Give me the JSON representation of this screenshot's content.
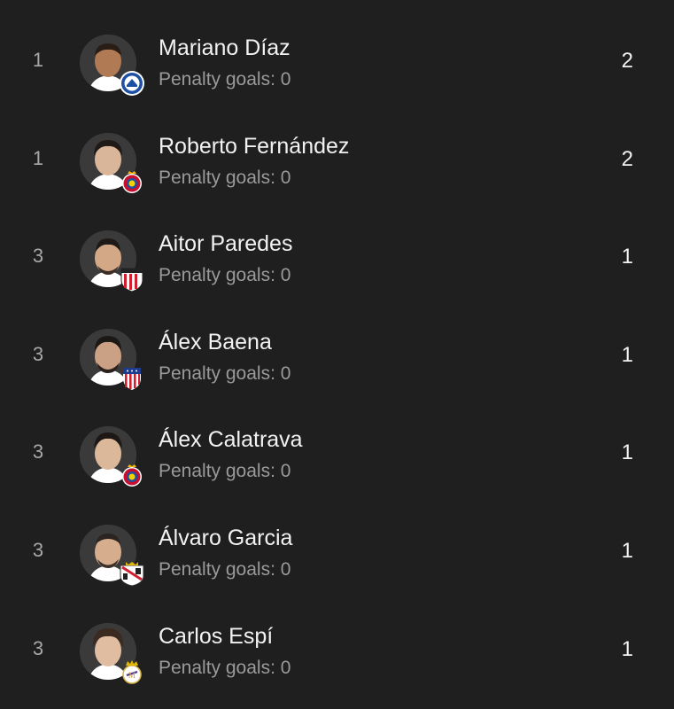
{
  "colors": {
    "background": "#1f1f1f",
    "rank_text": "#a8a8a8",
    "name_text": "#f2f2f2",
    "sub_text": "#9a9a9a"
  },
  "players": [
    {
      "rank": "1",
      "name": "Mariano Díaz",
      "penalty": "Penalty goals: 0",
      "goals": "2",
      "crest_icon": "alaves-crest-icon",
      "skin": "#b07a55",
      "hair": "#2a1d16"
    },
    {
      "rank": "1",
      "name": "Roberto Fernández",
      "penalty": "Penalty goals: 0",
      "goals": "2",
      "crest_icon": "espanyol-crest-icon",
      "skin": "#d9b59a",
      "hair": "#201a17"
    },
    {
      "rank": "3",
      "name": "Aitor Paredes",
      "penalty": "Penalty goals: 0",
      "goals": "1",
      "crest_icon": "athletic-crest-icon",
      "skin": "#d2a887",
      "hair": "#1f1a17"
    },
    {
      "rank": "3",
      "name": "Álex Baena",
      "penalty": "Penalty goals: 0",
      "goals": "1",
      "crest_icon": "atletico-crest-icon",
      "skin": "#caa184",
      "hair": "#1c1816"
    },
    {
      "rank": "3",
      "name": "Álex Calatrava",
      "penalty": "Penalty goals: 0",
      "goals": "1",
      "crest_icon": "espanyol-crest-icon",
      "skin": "#dcb89a",
      "hair": "#1d1815"
    },
    {
      "rank": "3",
      "name": "Álvaro Garcia",
      "penalty": "Penalty goals: 0",
      "goals": "1",
      "crest_icon": "rayo-crest-icon",
      "skin": "#d6ad8d",
      "hair": "#2b2420"
    },
    {
      "rank": "3",
      "name": "Carlos Espí",
      "penalty": "Penalty goals: 0",
      "goals": "1",
      "crest_icon": "real-madrid-crest-icon",
      "skin": "#e0bda0",
      "hair": "#3a2a20"
    }
  ]
}
